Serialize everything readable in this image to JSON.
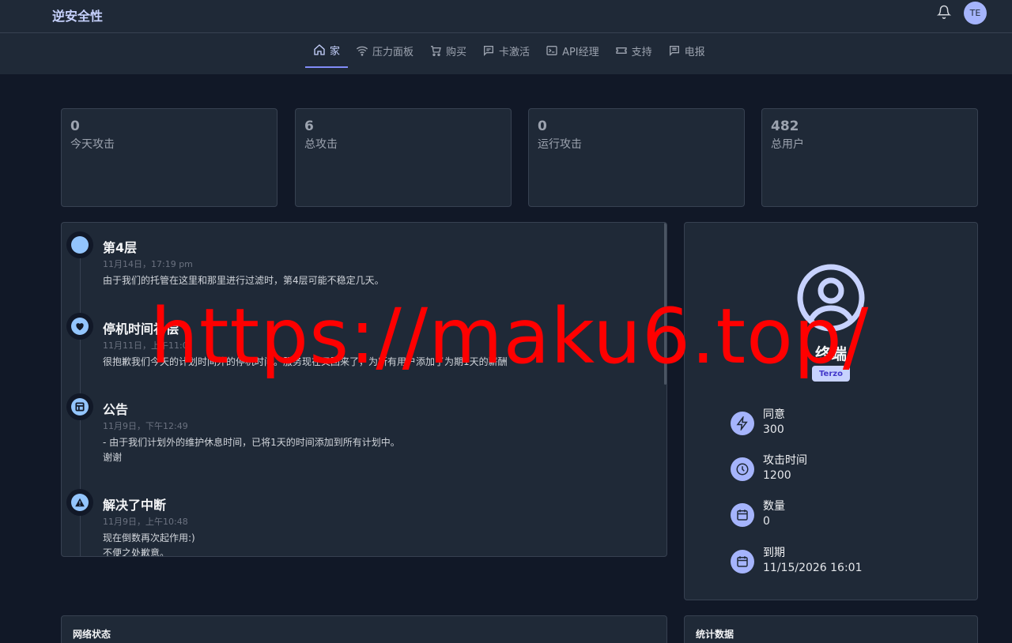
{
  "brand": "逆安全性",
  "user_initials": "TE",
  "nav": [
    {
      "label": "家",
      "icon": "home-icon"
    },
    {
      "label": "压力面板",
      "icon": "wifi-icon"
    },
    {
      "label": "购买",
      "icon": "cart-icon"
    },
    {
      "label": "卡激活",
      "icon": "message-icon"
    },
    {
      "label": "API经理",
      "icon": "terminal-icon"
    },
    {
      "label": "支持",
      "icon": "ticket-icon"
    },
    {
      "label": "电报",
      "icon": "chat-icon"
    }
  ],
  "stats": [
    {
      "value": "0",
      "label": "今天攻击"
    },
    {
      "value": "6",
      "label": "总攻击"
    },
    {
      "value": "0",
      "label": "运行攻击"
    },
    {
      "value": "482",
      "label": "总用户"
    }
  ],
  "timeline": [
    {
      "title": "第4层",
      "date": "11月14日，17:19 pm",
      "text": "由于我们的托管在这里和那里进行过滤时，第4层可能不稳定几天。",
      "text2": "",
      "icon": "circle-icon"
    },
    {
      "title": "停机时间补偿",
      "date": "11月11日，上午11:0",
      "text": "很抱歉我们今天的计划时间外的停机时间。服务现在又回来了，为所有用户添加了为期1天的薪酬",
      "text2": "",
      "icon": "heart-icon"
    },
    {
      "title": "公告",
      "date": "11月9日，下午12:49",
      "text": "- 由于我们计划外的维护休息时间，已将1天的时间添加到所有计划中。",
      "text2": "谢谢",
      "icon": "layout-icon"
    },
    {
      "title": "解决了中断",
      "date": "11月9日，上午10:48",
      "text": "现在倒数再次起作用:)",
      "text2": "不便之处歉意。",
      "icon": "warning-icon"
    }
  ],
  "profile": {
    "name": "终端",
    "role": "Terzo",
    "rows": [
      {
        "label": "同意",
        "value": "300",
        "icon": "bolt-icon"
      },
      {
        "label": "攻击时间",
        "value": "1200",
        "icon": "clock-icon"
      },
      {
        "label": "数量",
        "value": "0",
        "icon": "calendar-icon"
      },
      {
        "label": "到期",
        "value": "11/15/2026 16:01",
        "icon": "calendar-icon"
      }
    ]
  },
  "bottom": {
    "network_status": "网络状态",
    "statistics": "统计数据"
  },
  "watermark": "https://maku6.top/",
  "colors": {
    "background": "#111827",
    "panel": "#1f2937",
    "accent": "#a5b4fc",
    "watermark": "#ff0000"
  }
}
